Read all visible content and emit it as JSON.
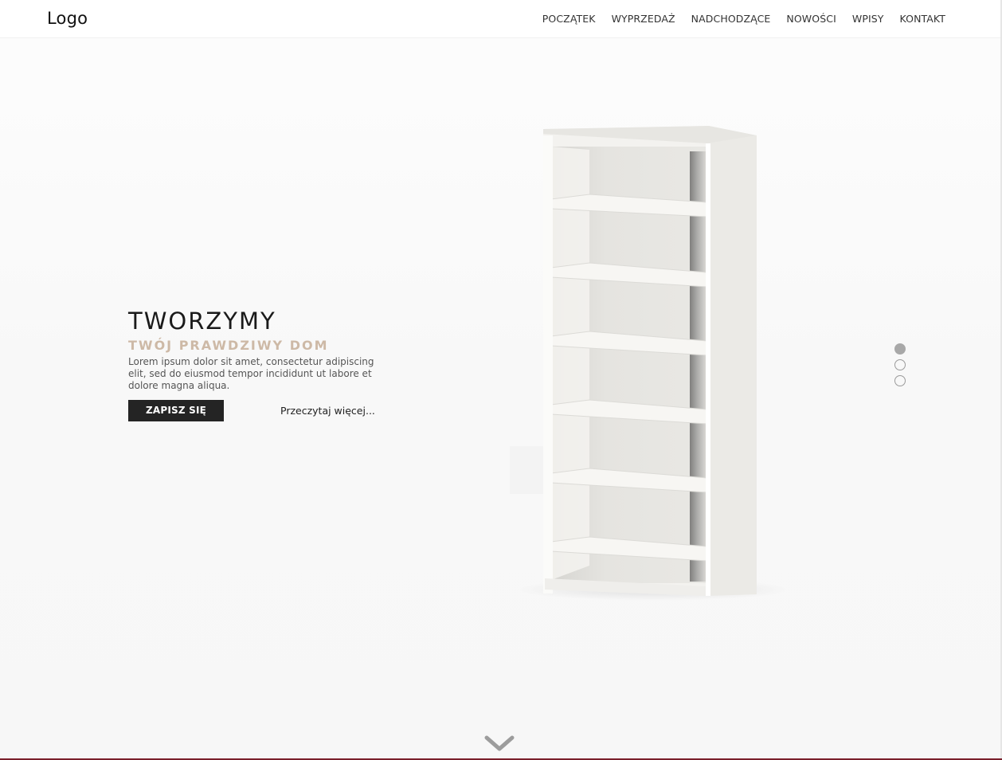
{
  "header": {
    "logo": "Logo",
    "nav": [
      "POCZĄTEK",
      "WYPRZEDAŻ",
      "NADCHODZĄCE",
      "NOWOŚCI",
      "WPISY",
      "KONTAKT"
    ]
  },
  "hero": {
    "title": "TWORZYMY",
    "subtitle": "TWÓJ PRAWDZIWY DOM",
    "description": "Lorem ipsum dolor sit amet, consectetur adipiscing elit, sed do eiusmod tempor incididunt ut labore et dolore magna aliqua.",
    "signup_label": "ZAPISZ SIĘ",
    "readmore_label": "Przeczytaj więcej..."
  },
  "slider": {
    "total": 3,
    "active_index": 0
  },
  "icons": {
    "scroll_down": "chevron-down-icon",
    "product": "bookshelf-image"
  },
  "colors": {
    "accent": "#cdb9a6",
    "button": "#242424",
    "bottom_line": "#7a1f2b"
  }
}
